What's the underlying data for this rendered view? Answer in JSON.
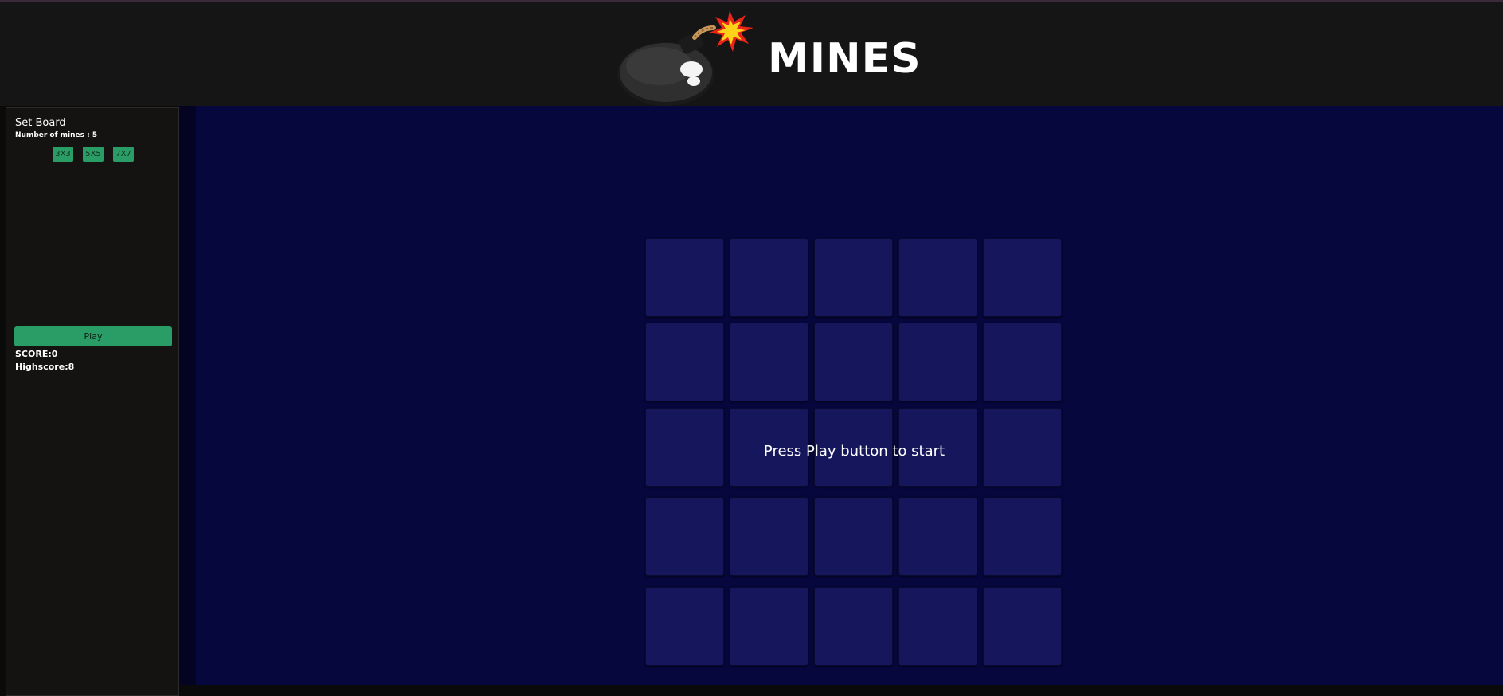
{
  "header": {
    "title": "MINES",
    "logo_icon": "bomb-icon"
  },
  "sidebar": {
    "title": "Set Board",
    "mines_label": "Number of mines : 5",
    "size_options": [
      "3X3",
      "5X5",
      "7X7"
    ],
    "play_label": "Play",
    "score_label": "SCORE:0",
    "highscore_label": "Highscore:8"
  },
  "board": {
    "rows": 5,
    "cols": 5,
    "status_message": "Press Play button to start"
  },
  "colors": {
    "accent": "#2a9d66",
    "main_bg": "#06073c",
    "tile": "#15165c",
    "header_bg": "#161515",
    "sidebar_bg": "#151311"
  }
}
